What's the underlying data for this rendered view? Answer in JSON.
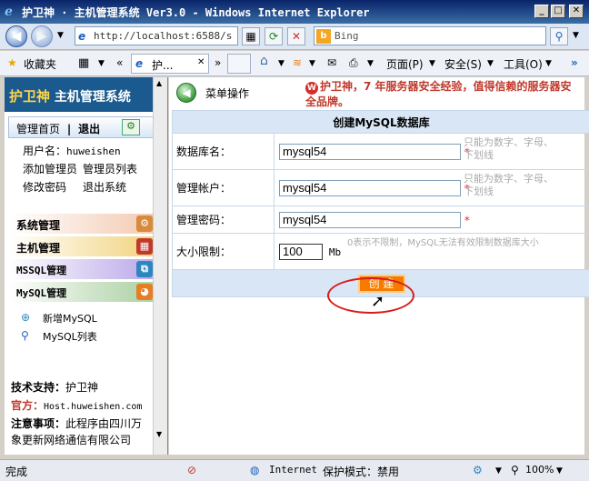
{
  "window": {
    "title": "护卫神 · 主机管理系统 Ver3.0 - Windows Internet Explorer",
    "minimize": "_",
    "maximize": "□",
    "close": "✕"
  },
  "address_bar": {
    "url": "http://localhost:6588/s",
    "search_placeholder": "Bing"
  },
  "command_bar": {
    "favorites": "收藏夹",
    "tab_label": "护...",
    "page_menu": "页面(P)",
    "safety_menu": "安全(S)",
    "tools_menu": "工具(O)"
  },
  "sidebar": {
    "logo_big": "护卫神",
    "logo_rest": " 主机管理系统",
    "home": "管理首页",
    "separator": "|",
    "logout": "退出",
    "username_label": "用户名：",
    "username": "huweishen",
    "add_admin": "添加管理员",
    "admin_list": "管理员列表",
    "change_password": "修改密码",
    "exit_system": "退出系统",
    "menus": [
      {
        "label": "系统管理"
      },
      {
        "label": "主机管理"
      },
      {
        "label": "MSSQL管理"
      },
      {
        "label": "MySQL管理"
      }
    ],
    "add_mysql": "新增MySQL",
    "mysql_list": "MySQL列表",
    "support_label": "技术支持：",
    "support_value": "护卫神",
    "official_label": "官方：",
    "official_value": "Host.huweishen.com",
    "notice_label": "注意事项：",
    "notice_value": "此程序由四川万象更新网络通信有限公司"
  },
  "main": {
    "menu_label": "菜单操作",
    "ad_text": "护卫神，7 年服务器安全经验，值得信赖的服务器安全品牌。",
    "form_title": "创建MySQL数据库",
    "fields": [
      {
        "label": "数据库名：",
        "value": "mysql54",
        "star": "*",
        "hint": "只能为数字、字母、下划线"
      },
      {
        "label": "管理帐户：",
        "value": "mysql54",
        "star": "*",
        "hint": "只能为数字、字母、下划线"
      },
      {
        "label": "管理密码：",
        "value": "mysql54",
        "star": "*",
        "hint": ""
      }
    ],
    "size": {
      "label": "大小限制：",
      "value": "100",
      "unit": "Mb",
      "hint": "0表示不限制，MySQL无法有效限制数据库大小"
    },
    "create_button": "创 建"
  },
  "status_bar": {
    "status": "完成",
    "zone": "Internet",
    "protected_mode": "保护模式：禁用",
    "zoom": "100%"
  }
}
